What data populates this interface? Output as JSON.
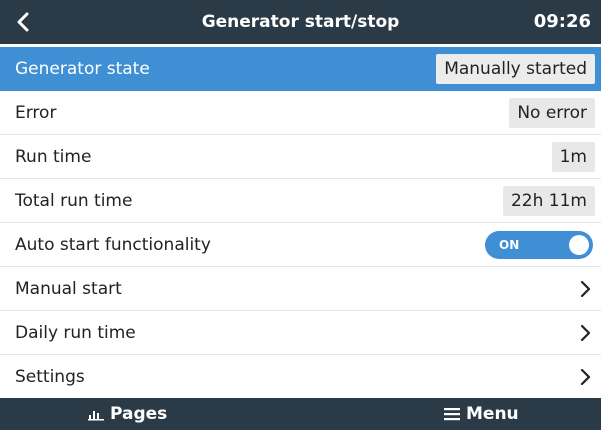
{
  "header": {
    "title": "Generator start/stop",
    "time": "09:26",
    "back_icon": "chevron-left-icon"
  },
  "rows": [
    {
      "label": "Generator state",
      "value": "Manually started",
      "type": "value",
      "selected": true
    },
    {
      "label": "Error",
      "value": "No error",
      "type": "value"
    },
    {
      "label": "Run time",
      "value": "1m",
      "type": "value"
    },
    {
      "label": "Total run time",
      "value": "22h 11m",
      "type": "value"
    },
    {
      "label": "Auto start functionality",
      "value": "ON",
      "type": "toggle",
      "toggle_state": "on"
    },
    {
      "label": "Manual start",
      "type": "submenu",
      "icon": "chevron-right-icon"
    },
    {
      "label": "Daily run time",
      "type": "submenu",
      "icon": "chevron-right-icon"
    },
    {
      "label": "Settings",
      "type": "submenu",
      "icon": "chevron-right-icon"
    }
  ],
  "footer": {
    "pages_label": "Pages",
    "pages_icon": "bar-chart-icon",
    "menu_label": "Menu",
    "menu_icon": "hamburger-icon"
  },
  "colors": {
    "bar_bg": "#2b3a47",
    "accent": "#3f8fd4",
    "value_bg": "#e8e8e8"
  }
}
